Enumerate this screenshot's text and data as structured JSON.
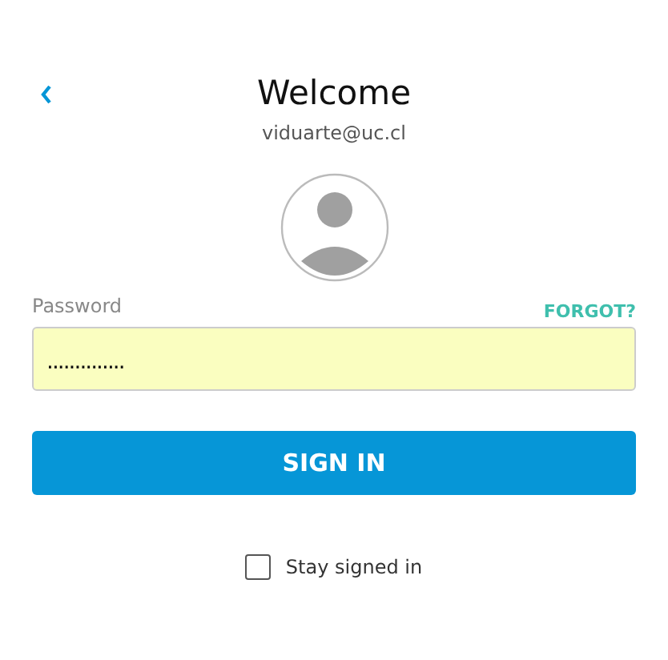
{
  "header": {
    "title": "Welcome",
    "email": "viduarte@uc.cl"
  },
  "password": {
    "label": "Password",
    "value": "..............",
    "forgot_link": "FORGOT?"
  },
  "sign_in_button": "SIGN IN",
  "stay_signed_in": {
    "label": "Stay signed in",
    "checked": false
  }
}
